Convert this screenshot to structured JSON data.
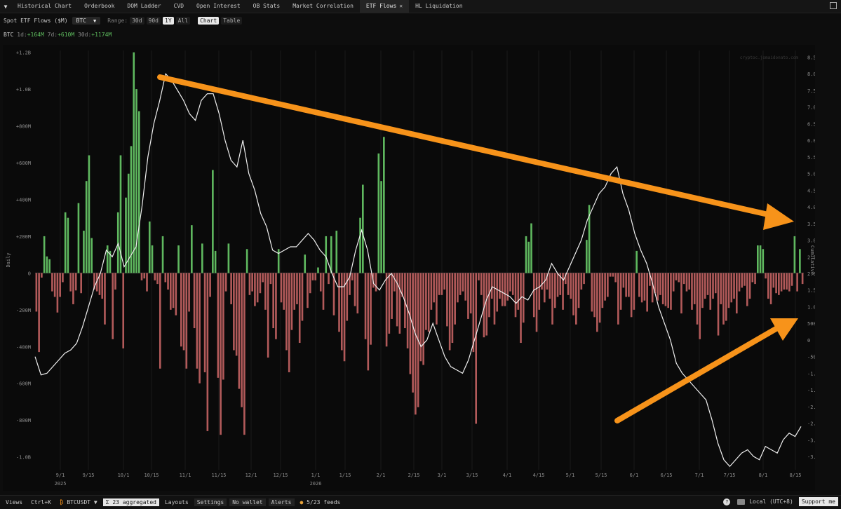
{
  "tabs": [
    {
      "label": "Historical Chart",
      "active": false
    },
    {
      "label": "Orderbook",
      "active": false
    },
    {
      "label": "DOM Ladder",
      "active": false
    },
    {
      "label": "CVD",
      "active": false
    },
    {
      "label": "Open Interest",
      "active": false
    },
    {
      "label": "OB Stats",
      "active": false
    },
    {
      "label": "Market Correlation",
      "active": false
    },
    {
      "label": "ETF Flows",
      "active": true
    },
    {
      "label": "HL Liquidation",
      "active": false
    }
  ],
  "tab_close_glyph": "✕",
  "toolbar": {
    "title": "Spot ETF Flows ($M)",
    "asset": "BTC",
    "range_label": "Range:",
    "ranges": [
      {
        "label": "30d",
        "on": false
      },
      {
        "label": "90d",
        "on": false
      },
      {
        "label": "1Y",
        "on": true
      },
      {
        "label": "All",
        "on": false
      }
    ],
    "views": [
      {
        "label": "Chart",
        "on": true
      },
      {
        "label": "Table",
        "on": false
      }
    ]
  },
  "stats": {
    "asset": "BTC",
    "d1_label": "1d:",
    "d1": "+164M",
    "d7_label": "7d:",
    "d7": "+610M",
    "d30_label": "30d:",
    "d30": "+1174M"
  },
  "chart_data": {
    "type": "bar",
    "watermark": "cryptoc.jomaidonato.com",
    "left_axis": {
      "label": "Daily",
      "ticks": [
        "+1.2B",
        "+1.0B",
        "+800M",
        "+600M",
        "+400M",
        "+200M",
        "0",
        "-200M",
        "-400M",
        "-600M",
        "-800M",
        "-1.0B"
      ],
      "range_millions": [
        -1070,
        1210
      ]
    },
    "right_axis": {
      "label": "Cumulative",
      "ticks": [
        "8.5B",
        "8.0B",
        "7.5B",
        "7.0B",
        "6.5B",
        "6.0B",
        "5.5B",
        "5.0B",
        "4.5B",
        "4.0B",
        "3.5B",
        "3.0B",
        "2.5B",
        "2.0B",
        "1.5B",
        "1.0B",
        "500M",
        "0",
        "-500M",
        "-1.0B",
        "-1.5B",
        "-2.0B",
        "-2.5B",
        "-3.0B",
        "-3.5B"
      ],
      "range_billions": [
        -3.9,
        8.7
      ]
    },
    "x_ticks": [
      {
        "label": "9/1",
        "sub": "2025"
      },
      {
        "label": "9/15",
        "sub": ""
      },
      {
        "label": "10/1",
        "sub": ""
      },
      {
        "label": "10/15",
        "sub": ""
      },
      {
        "label": "11/1",
        "sub": ""
      },
      {
        "label": "11/15",
        "sub": ""
      },
      {
        "label": "12/1",
        "sub": ""
      },
      {
        "label": "12/15",
        "sub": ""
      },
      {
        "label": "1/1",
        "sub": "2026"
      },
      {
        "label": "1/15",
        "sub": ""
      },
      {
        "label": "2/1",
        "sub": ""
      },
      {
        "label": "2/15",
        "sub": ""
      },
      {
        "label": "3/1",
        "sub": ""
      },
      {
        "label": "3/15",
        "sub": ""
      },
      {
        "label": "4/1",
        "sub": ""
      },
      {
        "label": "4/15",
        "sub": ""
      },
      {
        "label": "5/1",
        "sub": ""
      },
      {
        "label": "5/15",
        "sub": ""
      },
      {
        "label": "6/1",
        "sub": ""
      },
      {
        "label": "6/15",
        "sub": ""
      },
      {
        "label": "7/1",
        "sub": ""
      },
      {
        "label": "7/15",
        "sub": ""
      },
      {
        "label": "8/1",
        "sub": ""
      },
      {
        "label": "8/15",
        "sub": ""
      }
    ],
    "daily_flows_millions": [
      -210,
      -430,
      -25,
      200,
      90,
      75,
      -100,
      -130,
      -215,
      -130,
      -50,
      330,
      300,
      -100,
      -170,
      -95,
      380,
      -110,
      230,
      500,
      640,
      190,
      -90,
      -100,
      -120,
      -140,
      -280,
      150,
      120,
      -360,
      -90,
      330,
      640,
      -410,
      410,
      540,
      690,
      1200,
      1000,
      880,
      -40,
      -30,
      -100,
      280,
      150,
      -40,
      -60,
      -520,
      200,
      -50,
      -90,
      -200,
      -190,
      -230,
      150,
      -400,
      -420,
      -520,
      -210,
      260,
      -300,
      -520,
      -600,
      160,
      -540,
      -860,
      -130,
      560,
      120,
      -570,
      -880,
      -580,
      -100,
      160,
      -170,
      -420,
      -450,
      -630,
      -730,
      -880,
      130,
      -120,
      -100,
      -180,
      -160,
      -110,
      -50,
      -200,
      -460,
      -60,
      -300,
      -360,
      130,
      -160,
      -200,
      -420,
      -540,
      -310,
      -200,
      -170,
      -380,
      -260,
      100,
      -190,
      -110,
      -40,
      -40,
      30,
      -100,
      -200,
      200,
      -60,
      200,
      -230,
      230,
      -320,
      -420,
      -480,
      -260,
      -120,
      -40,
      -180,
      -220,
      300,
      480,
      -360,
      -530,
      -390,
      -80,
      -100,
      650,
      500,
      740,
      -400,
      -330,
      -250,
      -100,
      -290,
      -330,
      -130,
      -300,
      -410,
      -550,
      -650,
      -770,
      -730,
      -480,
      -500,
      -310,
      -320,
      -200,
      -160,
      -280,
      -120,
      -120,
      -90,
      -290,
      -420,
      -380,
      -280,
      -160,
      -120,
      -100,
      -150,
      -250,
      -220,
      -430,
      -820,
      -40,
      -120,
      -350,
      -340,
      -240,
      -140,
      -280,
      -210,
      -140,
      -180,
      -180,
      -150,
      -100,
      -120,
      -240,
      -200,
      -380,
      -270,
      200,
      170,
      270,
      -240,
      -320,
      -200,
      -90,
      -160,
      -90,
      -140,
      -280,
      -190,
      -130,
      -120,
      -200,
      -60,
      -120,
      -140,
      -230,
      -280,
      -190,
      -90,
      -60,
      180,
      370,
      -210,
      -240,
      -320,
      -270,
      -190,
      -150,
      -130,
      -20,
      -20,
      -50,
      -280,
      -200,
      -80,
      -130,
      -130,
      -240,
      -200,
      120,
      -130,
      -160,
      -150,
      -210,
      -70,
      -160,
      -110,
      -150,
      -120,
      -170,
      -180,
      -190,
      -200,
      -100,
      -40,
      -50,
      -220,
      -60,
      -100,
      -90,
      -200,
      -170,
      -280,
      -360,
      -190,
      -140,
      -120,
      -200,
      -140,
      -110,
      -340,
      -170,
      -280,
      -260,
      -190,
      -160,
      -140,
      -220,
      -100,
      -80,
      -70,
      -180,
      -140,
      -50,
      -60,
      150,
      150,
      130,
      -30,
      -140,
      -170,
      -80,
      -110,
      -120,
      -100,
      -90,
      -90,
      -100,
      -70,
      200,
      -100,
      130,
      -60
    ],
    "cumulative_billions": [
      -0.5,
      -1.05,
      -1.0,
      -0.8,
      -0.6,
      -0.4,
      -0.3,
      -0.1,
      0.4,
      1.0,
      1.6,
      2.0,
      2.7,
      2.5,
      2.9,
      2.2,
      2.5,
      2.8,
      4.0,
      5.5,
      6.5,
      7.2,
      8.0,
      7.8,
      7.5,
      7.2,
      6.8,
      6.6,
      7.2,
      7.4,
      7.4,
      6.8,
      6.0,
      5.4,
      5.2,
      6.0,
      5.0,
      4.5,
      3.8,
      3.4,
      2.7,
      2.6,
      2.7,
      2.8,
      2.8,
      3.0,
      3.2,
      3.0,
      2.7,
      2.5,
      2.0,
      1.6,
      1.6,
      1.9,
      2.7,
      3.3,
      2.7,
      1.7,
      1.5,
      1.8,
      2.0,
      1.7,
      1.3,
      0.8,
      0.2,
      -0.2,
      0.0,
      0.5,
      0.0,
      -0.5,
      -0.8,
      -0.9,
      -1.0,
      -0.6,
      0.0,
      0.6,
      1.2,
      1.6,
      1.5,
      1.4,
      1.3,
      1.1,
      1.3,
      1.2,
      1.5,
      1.6,
      1.8,
      2.3,
      2.0,
      1.8,
      2.2,
      2.6,
      3.0,
      3.6,
      4.0,
      4.4,
      4.6,
      5.0,
      5.2,
      4.4,
      3.9,
      3.2,
      2.7,
      2.3,
      1.7,
      1.0,
      0.5,
      0.0,
      -0.7,
      -1.0,
      -1.2,
      -1.4,
      -1.6,
      -1.8,
      -2.4,
      -3.1,
      -3.6,
      -3.8,
      -3.6,
      -3.4,
      -3.3,
      -3.5,
      -3.6,
      -3.2,
      -3.3,
      -3.4,
      -3.0,
      -2.8,
      -2.9,
      -2.6
    ]
  },
  "annotations": {
    "arrow_color": "#f7931a"
  },
  "statusbar": {
    "views": "Views",
    "shortcut": "Ctrl+K",
    "pair": "BTCUSDT",
    "pair_caret": "▼",
    "aggregated": "Σ 23 aggregated",
    "layouts": "Layouts",
    "settings": "Settings",
    "wallet": "No wallet",
    "alerts": "Alerts",
    "feeds": "5/23 feeds",
    "help": "?",
    "tz": "Local (UTC+8)",
    "support": "Support me"
  }
}
